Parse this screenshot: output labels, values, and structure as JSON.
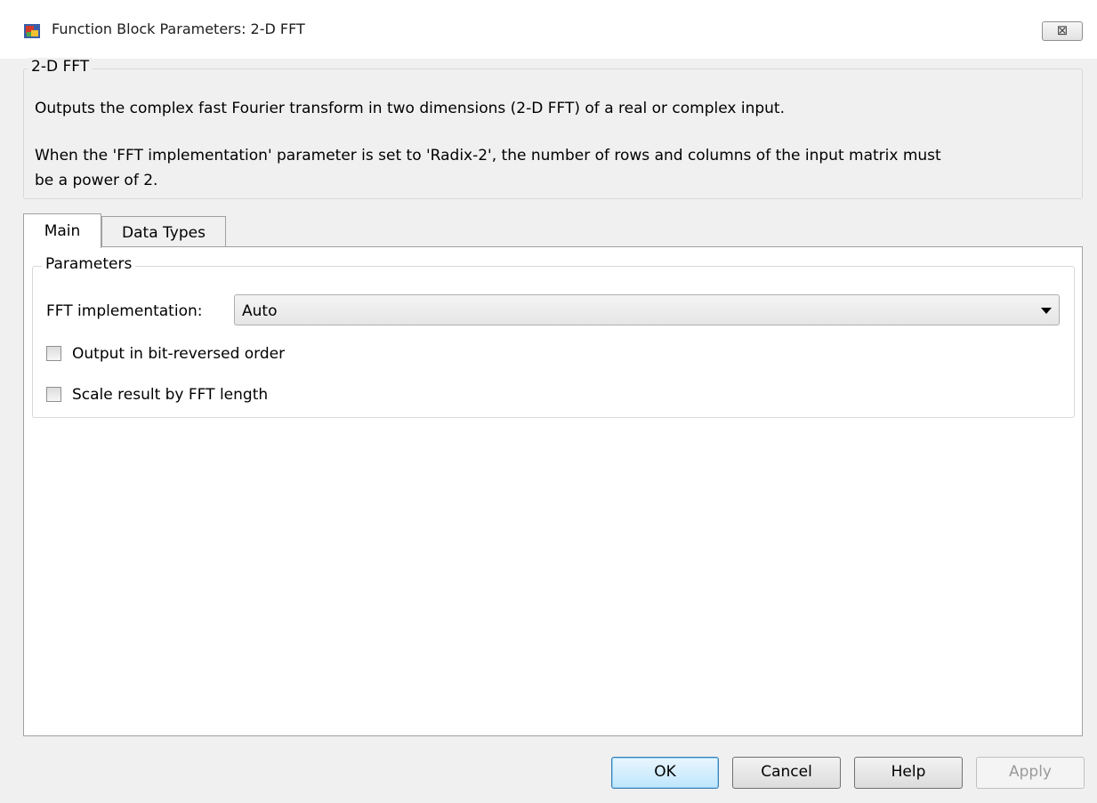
{
  "window": {
    "title": "Function Block Parameters: 2-D FFT",
    "close_symbol": "⊠"
  },
  "description": {
    "group_title": "2-D FFT",
    "line1": "Outputs the complex fast Fourier transform in two dimensions (2-D FFT) of a real or complex input.",
    "line2": "When the 'FFT implementation' parameter is set to 'Radix-2', the number of rows and columns of the input matrix must",
    "line3": "be a power of 2."
  },
  "tabs": [
    {
      "label": "Main",
      "active": true
    },
    {
      "label": "Data Types",
      "active": false
    }
  ],
  "parameters": {
    "group_title": "Parameters",
    "fft_implementation": {
      "label": "FFT implementation:",
      "value": "Auto"
    },
    "bit_reversed": {
      "label": "Output in bit-reversed order",
      "checked": false
    },
    "scale_result": {
      "label": "Scale result by FFT length",
      "checked": false
    }
  },
  "buttons": {
    "ok": "OK",
    "cancel": "Cancel",
    "help": "Help",
    "apply": "Apply"
  },
  "icons": {
    "app": "simulink-block-icon",
    "close": "close-icon",
    "dropdown": "chevron-down-icon"
  },
  "colors": {
    "ok_border": "#3c7fb1",
    "disabled_text": "#9a9a9a"
  }
}
